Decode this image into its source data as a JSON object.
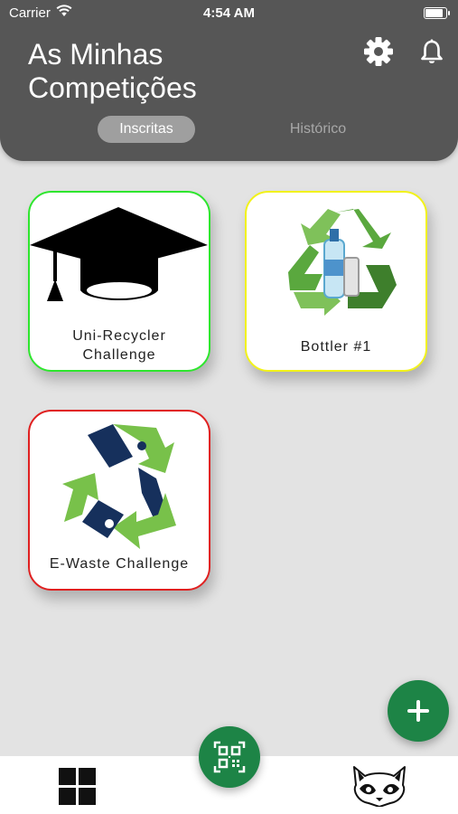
{
  "status_bar": {
    "carrier": "Carrier",
    "time": "4:54 AM",
    "battery_level": 1.0
  },
  "header": {
    "title_line1": "As Minhas",
    "title_line2": "Competições"
  },
  "tabs": [
    {
      "label": "Inscritas",
      "active": true
    },
    {
      "label": "Histórico",
      "active": false
    }
  ],
  "competitions": [
    {
      "line1": "Uni-Recycler",
      "line2": "Challenge",
      "border_color": "#2ee62e",
      "icon": "graduation-cap-icon"
    },
    {
      "line1": "Bottler #1",
      "border_color": "#f2f21a",
      "icon": "recycle-bottle-icon"
    },
    {
      "line1": "E-Waste Challenge",
      "border_color": "#e02020",
      "icon": "e-waste-recycle-icon"
    }
  ],
  "colors": {
    "header_bg": "#565656",
    "accent_green": "#1d8446",
    "page_bg": "#e3e3e3"
  },
  "icons": {
    "settings": "gear-icon",
    "notifications": "bell-icon",
    "add": "plus-icon",
    "scan": "qr-code-icon",
    "home_nav": "grid-icon",
    "profile_nav": "raccoon-icon"
  }
}
